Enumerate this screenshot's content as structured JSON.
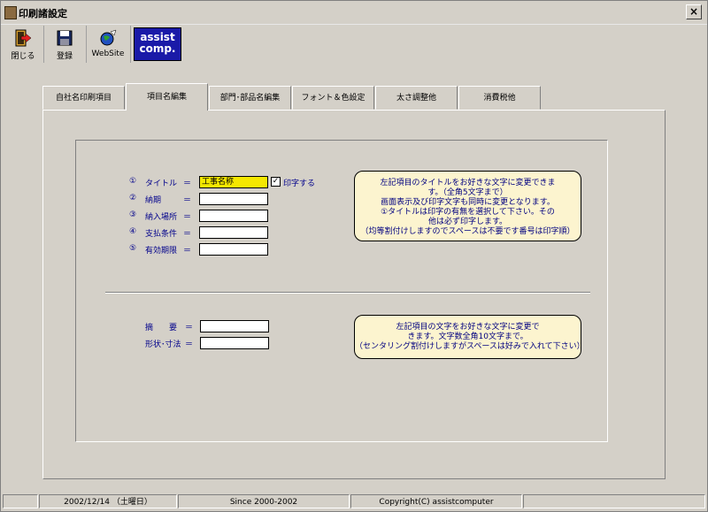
{
  "window": {
    "title": "印刷諸設定",
    "close_glyph": "×"
  },
  "toolbar": {
    "close_label": "閉じる",
    "save_label": "登録",
    "website_label": "WebSite",
    "logo_line1": "assist",
    "logo_line2": "comp."
  },
  "tabs": [
    {
      "label": "自社名印刷項目"
    },
    {
      "label": "項目名編集"
    },
    {
      "label": "部門･部品名編集"
    },
    {
      "label": "フォント＆色設定"
    },
    {
      "label": "太さ調整他"
    },
    {
      "label": "消費税他"
    }
  ],
  "active_tab": "項目名編集",
  "items": [
    {
      "num": "①",
      "label": "タイトル",
      "eq": "＝",
      "value": "工事名称"
    },
    {
      "num": "②",
      "label": "納期",
      "eq": "＝",
      "value": ""
    },
    {
      "num": "③",
      "label": "納入場所",
      "eq": "＝",
      "value": ""
    },
    {
      "num": "④",
      "label": "支払条件",
      "eq": "＝",
      "value": ""
    },
    {
      "num": "⑤",
      "label": "有効期限",
      "eq": "＝",
      "value": ""
    }
  ],
  "print_checkbox": {
    "label": "印字する",
    "checked": true,
    "mark": "✓"
  },
  "note1": {
    "lines": [
      "左記項目のタイトルをお好きな文字に変更できま",
      "す。（全角5文字まで）",
      "画面表示及び印字文字も同時に変更となります。",
      "①タイトルは印字の有無を選択して下さい。その",
      "他は必ず印字します。",
      "（均等割付けしますのでスペースは不要です番号は印字順）"
    ]
  },
  "lower_items": [
    {
      "label": "摘　　要",
      "eq": "＝",
      "value": ""
    },
    {
      "label": "形状･寸法",
      "eq": "＝",
      "value": ""
    }
  ],
  "note2": {
    "lines": [
      "左記項目の文字をお好きな文字に変更で",
      "きます。文字数全角10文字まで。",
      "（センタリング割付けしますがスペースは好みで入れて下さい）"
    ]
  },
  "status": {
    "date": "2002/12/14 （土曜日）",
    "since": "Since 2000-2002",
    "copyright": "Copyright(C) assistcomputer"
  },
  "colors": {
    "label_blue": "#00008b",
    "highlight": "#f5e800",
    "note_bg": "#fcf4cf",
    "logo_bg": "#1a1aa8"
  }
}
